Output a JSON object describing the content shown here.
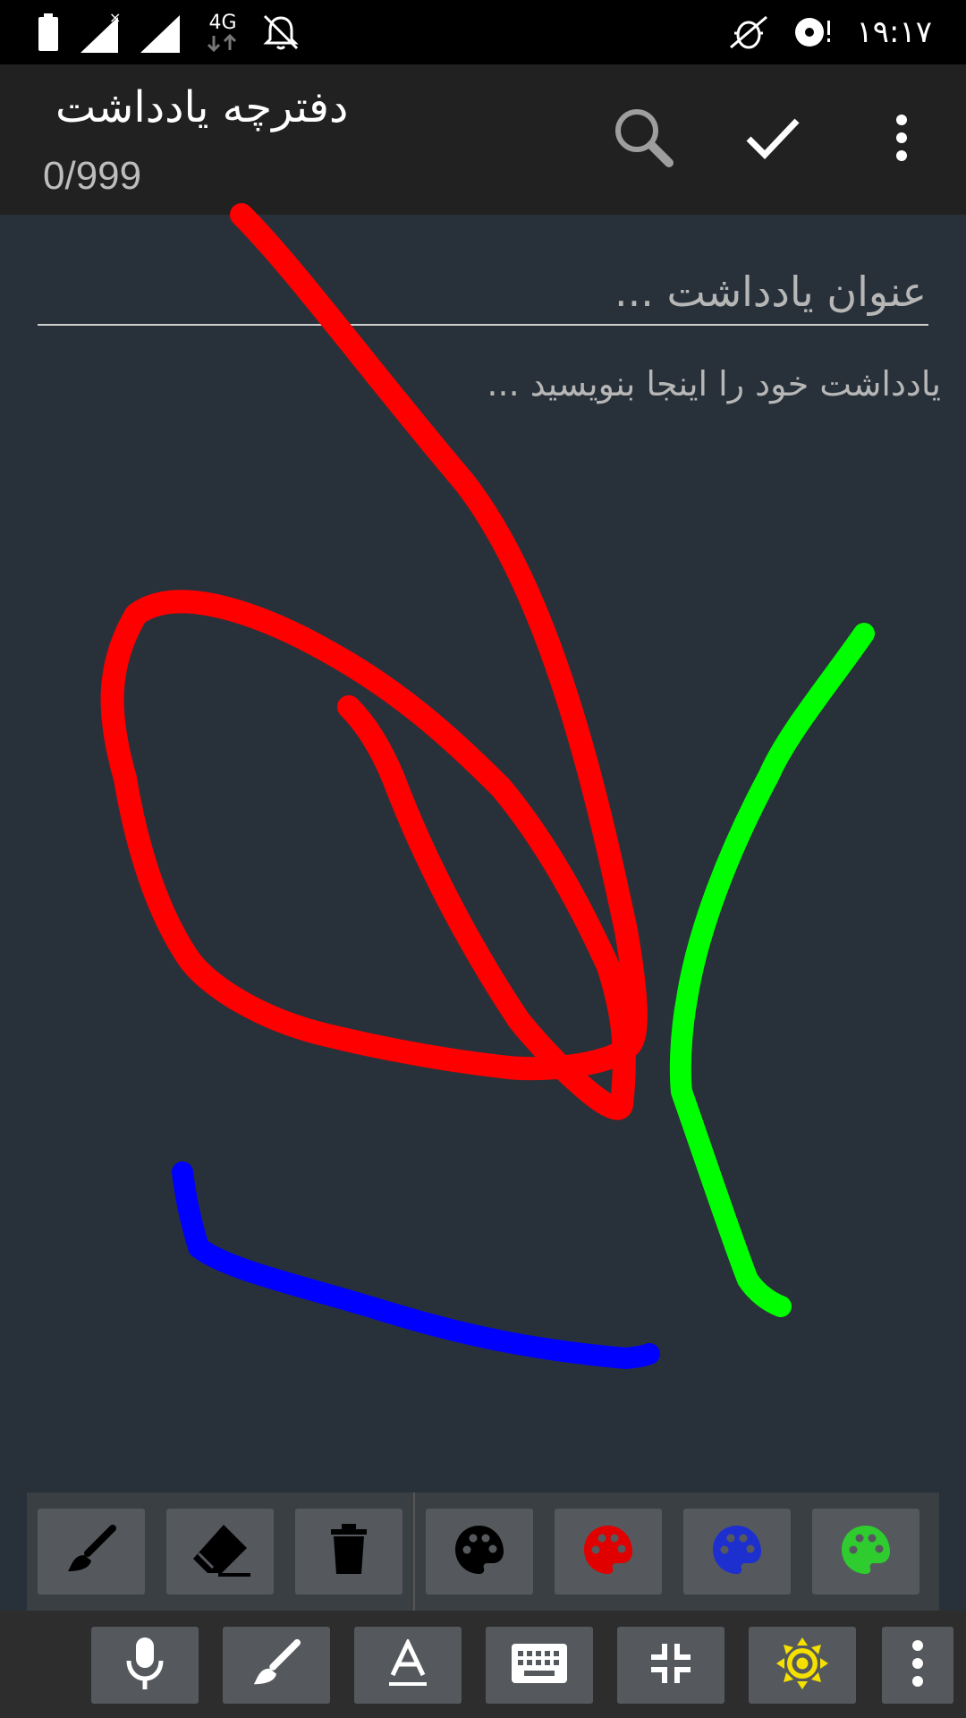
{
  "status_bar": {
    "time": "۱۹:۱۷",
    "icons": [
      "battery-icon",
      "signal-no-sim-icon",
      "signal-icon",
      "4g-data-icon",
      "notifications-off-icon",
      "bug-icon",
      "disc-alert-icon"
    ],
    "network_label": "4G"
  },
  "app_bar": {
    "title": "دفترچه یادداشت",
    "counter": "0/999",
    "actions": [
      "search-icon",
      "check-icon",
      "more-vert-icon"
    ]
  },
  "note": {
    "title_placeholder": "عنوان یادداشت ...",
    "body_placeholder": "یادداشت خود را اینجا بنویسید ..."
  },
  "drawing": {
    "strokes": [
      {
        "color": "#ff0000",
        "name": "red-long-stroke"
      },
      {
        "color": "#ff0000",
        "name": "red-loop-stroke"
      },
      {
        "color": "#00ff00",
        "name": "green-stroke"
      },
      {
        "color": "#0000ff",
        "name": "blue-stroke"
      }
    ]
  },
  "draw_toolbar": {
    "tools": [
      "brush-icon",
      "eraser-icon",
      "trash-icon"
    ],
    "palettes": [
      {
        "icon": "palette-icon",
        "color": "#000000"
      },
      {
        "icon": "palette-icon",
        "color": "#e00000"
      },
      {
        "icon": "palette-icon",
        "color": "#1e2fcf"
      },
      {
        "icon": "palette-icon",
        "color": "#2ecc2e"
      }
    ]
  },
  "bottom_bar": {
    "buttons": [
      "microphone-icon",
      "brush-icon",
      "text-format-icon",
      "keyboard-icon",
      "collapse-icon",
      "brightness-icon",
      "more-vert-icon"
    ],
    "accent": "#f5e000"
  }
}
